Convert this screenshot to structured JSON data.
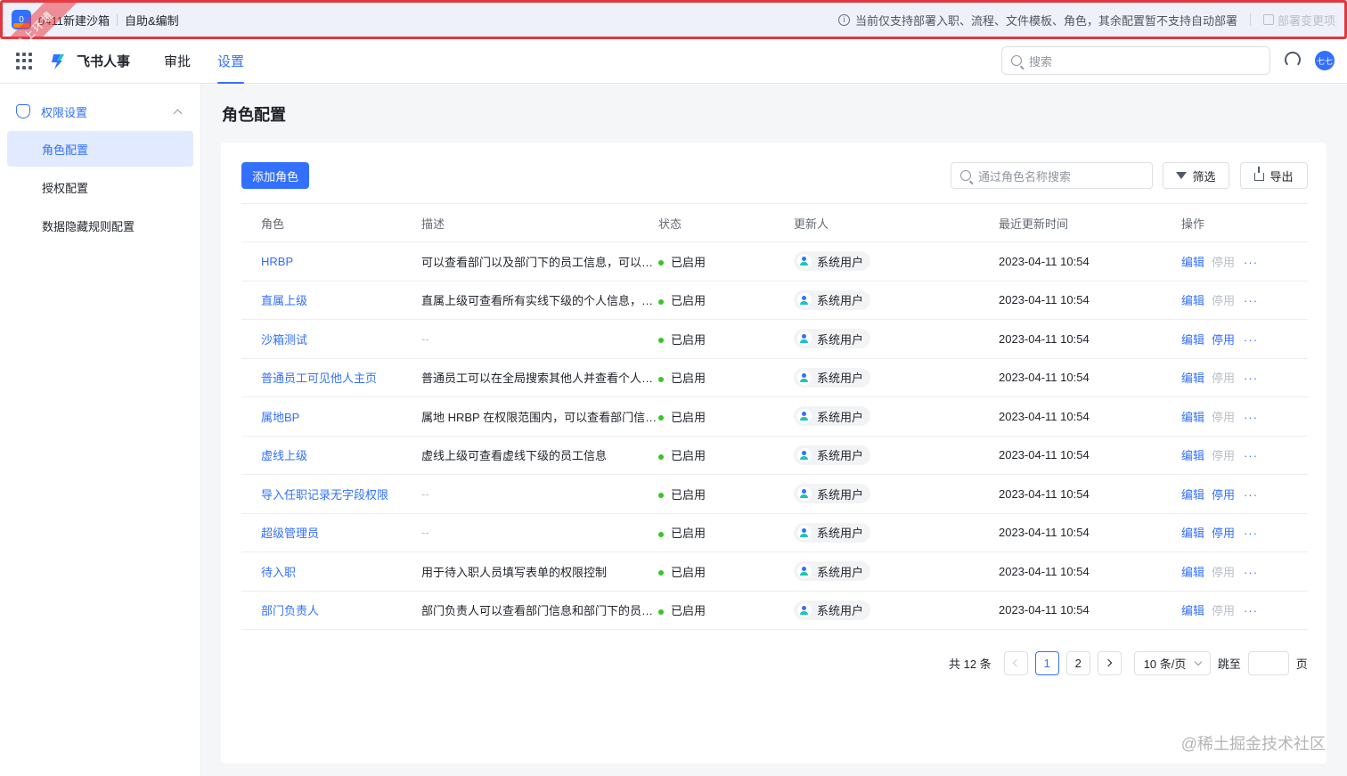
{
  "sandbox": {
    "badge": "0",
    "name": "0411新建沙箱",
    "mode": "自助&编制",
    "notice": "当前仅支持部署入职、流程、文件模板、角色，其余配置暂不支持自动部署",
    "deploy_label": "部署变更项",
    "ribbon": "线上环境"
  },
  "nav": {
    "app_name": "飞书人事",
    "tabs": [
      {
        "label": "审批",
        "active": false
      },
      {
        "label": "设置",
        "active": true
      }
    ],
    "search_placeholder": "搜索",
    "avatar_text": "七七"
  },
  "sidebar": {
    "group_label": "权限设置",
    "items": [
      {
        "label": "角色配置",
        "active": true
      },
      {
        "label": "授权配置",
        "active": false
      },
      {
        "label": "数据隐藏规则配置",
        "active": false
      }
    ]
  },
  "page": {
    "title": "角色配置",
    "add_button": "添加角色",
    "search_placeholder": "通过角色名称搜索",
    "filter_button": "筛选",
    "export_button": "导出"
  },
  "table": {
    "columns": [
      "角色",
      "描述",
      "状态",
      "更新人",
      "最近更新时间",
      "操作"
    ],
    "rows": [
      {
        "role": "HRBP",
        "desc": "可以查看部门以及部门下的员工信息，可以发…",
        "status": "已启用",
        "updater": "系统用户",
        "time": "2023-04-11 10:54",
        "edit": "编辑",
        "stop": "停用",
        "stop_enabled": false
      },
      {
        "role": "直属上级",
        "desc": "直属上级可查看所有实线下级的个人信息，但…",
        "status": "已启用",
        "updater": "系统用户",
        "time": "2023-04-11 10:54",
        "edit": "编辑",
        "stop": "停用",
        "stop_enabled": false
      },
      {
        "role": "沙箱测试",
        "desc": "--",
        "status": "已启用",
        "updater": "系统用户",
        "time": "2023-04-11 10:54",
        "edit": "编辑",
        "stop": "停用",
        "stop_enabled": true
      },
      {
        "role": "普通员工可见他人主页",
        "desc": "普通员工可以在全局搜索其他人并查看个人主页",
        "status": "已启用",
        "updater": "系统用户",
        "time": "2023-04-11 10:54",
        "edit": "编辑",
        "stop": "停用",
        "stop_enabled": false
      },
      {
        "role": "属地BP",
        "desc": "属地 HRBP 在权限范围内，可以查看部门信息…",
        "status": "已启用",
        "updater": "系统用户",
        "time": "2023-04-11 10:54",
        "edit": "编辑",
        "stop": "停用",
        "stop_enabled": false
      },
      {
        "role": "虚线上级",
        "desc": "虚线上级可查看虚线下级的员工信息",
        "status": "已启用",
        "updater": "系统用户",
        "time": "2023-04-11 10:54",
        "edit": "编辑",
        "stop": "停用",
        "stop_enabled": false
      },
      {
        "role": "导入任职记录无字段权限",
        "desc": "--",
        "status": "已启用",
        "updater": "系统用户",
        "time": "2023-04-11 10:54",
        "edit": "编辑",
        "stop": "停用",
        "stop_enabled": true
      },
      {
        "role": "超级管理员",
        "desc": "--",
        "status": "已启用",
        "updater": "系统用户",
        "time": "2023-04-11 10:54",
        "edit": "编辑",
        "stop": "停用",
        "stop_enabled": true
      },
      {
        "role": "待入职",
        "desc": "用于待入职人员填写表单的权限控制",
        "status": "已启用",
        "updater": "系统用户",
        "time": "2023-04-11 10:54",
        "edit": "编辑",
        "stop": "停用",
        "stop_enabled": false
      },
      {
        "role": "部门负责人",
        "desc": "部门负责人可以查看部门信息和部门下的员工…",
        "status": "已启用",
        "updater": "系统用户",
        "time": "2023-04-11 10:54",
        "edit": "编辑",
        "stop": "停用",
        "stop_enabled": false
      }
    ],
    "more": "···"
  },
  "pagination": {
    "total": "共 12 条",
    "pages": [
      "1",
      "2"
    ],
    "current": "1",
    "page_size": "10 条/页",
    "jump_label": "跳至",
    "page_suffix": "页"
  },
  "watermark": "@稀土掘金技术社区",
  "colors": {
    "accent": "#3370ff",
    "status_ok": "#34c724",
    "banner_border": "#e0383e"
  }
}
